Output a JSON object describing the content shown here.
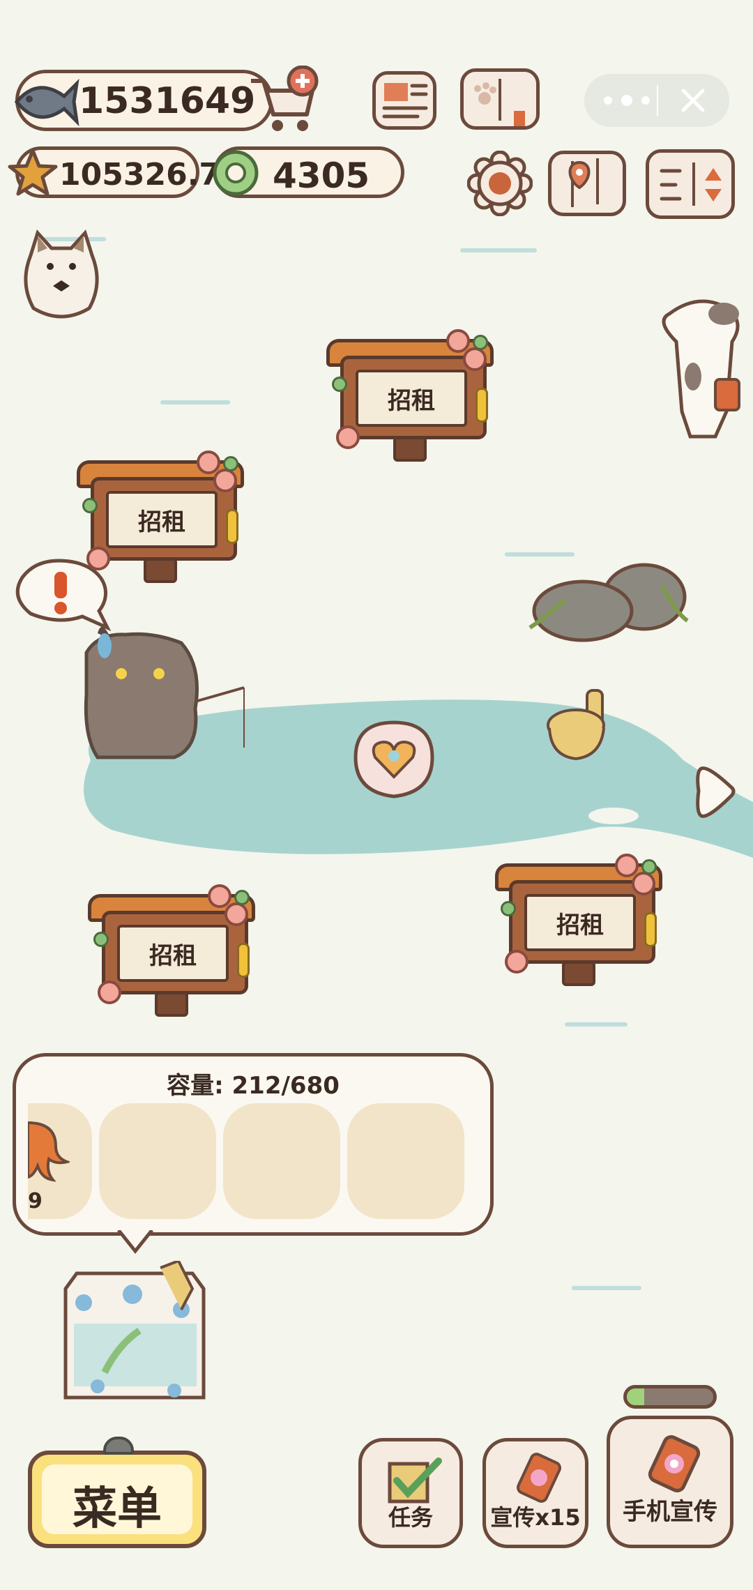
{
  "hud": {
    "fish_count": "1531649",
    "star_count": "105326.7",
    "ring_count": "4305"
  },
  "signs": [
    {
      "label": "招租"
    },
    {
      "label": "招租"
    },
    {
      "label": "招租"
    },
    {
      "label": "招租"
    }
  ],
  "storage": {
    "capacity_text": "容量: 212/680",
    "first_item_count": "9"
  },
  "bottom": {
    "menu_label": "菜单",
    "task_label": "任务",
    "promo_label": "宣传x15",
    "phone_promo_label": "手机宣传",
    "phone_promo_progress": 0.2
  },
  "icons": {
    "fish": "fish-icon",
    "cart": "cart-plus-icon",
    "newspaper": "newspaper-icon",
    "book": "paw-book-icon",
    "more": "more-dots-icon",
    "close": "close-icon",
    "star": "star-icon",
    "ring": "ring-coin-icon",
    "settings": "gear-icon",
    "map": "map-icon",
    "sort": "sort-arrows-icon",
    "arrow": "arrow-right-icon"
  },
  "colors": {
    "background": "#f4f5ec",
    "water": "#a7d3cf",
    "border": "#6b4a3c",
    "menu_yellow": "#fbe07e"
  }
}
